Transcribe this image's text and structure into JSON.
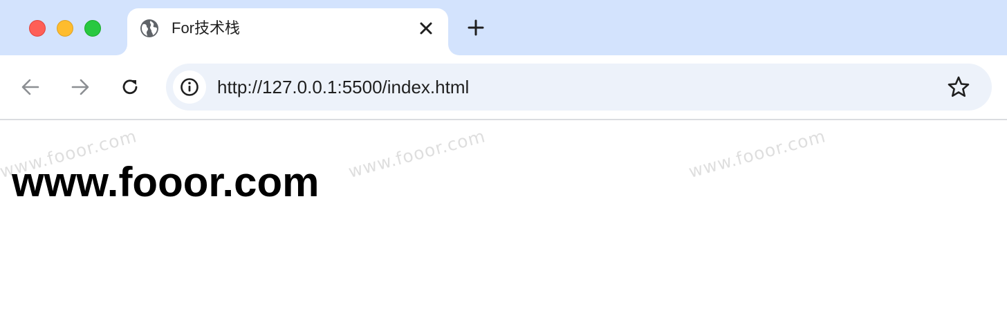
{
  "window_controls": {
    "close_color": "#fe5f57",
    "minimize_color": "#febc2e",
    "zoom_color": "#28c840"
  },
  "tab": {
    "title": "For技术栈",
    "favicon": "globe-icon",
    "close_icon": "close-icon"
  },
  "new_tab": {
    "icon": "plus-icon"
  },
  "toolbar": {
    "back_icon": "arrow-left-icon",
    "forward_icon": "arrow-right-icon",
    "reload_icon": "reload-icon"
  },
  "omnibox": {
    "site_info_icon": "info-icon",
    "url": "http://127.0.0.1:5500/index.html",
    "bookmark_icon": "star-icon"
  },
  "page": {
    "heading": "www.fooor.com",
    "watermarks": [
      "www.fooor.com",
      "www.fooor.com",
      "www.fooor.com"
    ]
  },
  "colors": {
    "tabstrip_bg": "#d3e3fd",
    "omnibox_bg": "#edf2fa"
  }
}
